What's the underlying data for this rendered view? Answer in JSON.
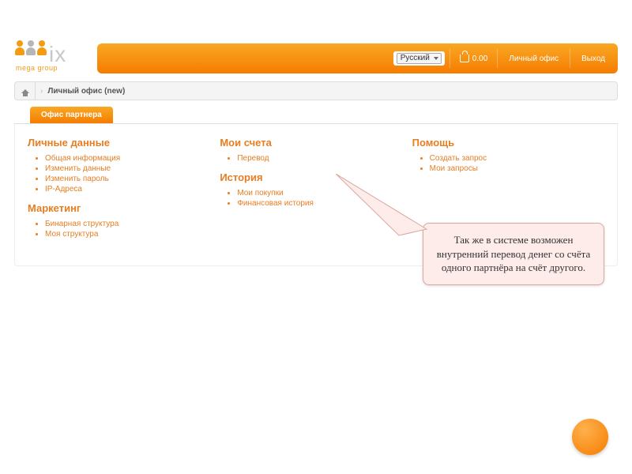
{
  "logo": {
    "text": "ix",
    "prefix_hint": "m",
    "sub": "mega group"
  },
  "topbar": {
    "language": "Русский",
    "balance": "0.00",
    "links": {
      "office": "Личный офис",
      "logout": "Выход"
    }
  },
  "breadcrumb": {
    "current": "Личный офис (new)"
  },
  "tab": {
    "label": "Офис партнера"
  },
  "columns": {
    "personal": {
      "title": "Личные данные",
      "items": [
        "Общая информация",
        "Изменить данные",
        "Изменить пароль",
        "IP-Адреса"
      ]
    },
    "marketing": {
      "title": "Маркетинг",
      "items": [
        "Бинарная структура",
        "Моя структура"
      ]
    },
    "accounts": {
      "title": "Мои счета",
      "items": [
        "Перевод"
      ]
    },
    "history": {
      "title": "История",
      "items": [
        "Мои покупки",
        "Финансовая история"
      ]
    },
    "help": {
      "title": "Помощь",
      "items": [
        "Создать запрос",
        "Мои запросы"
      ]
    }
  },
  "callout": {
    "text": "Так же в системе возможен внутренний перевод денег со счёта одного партнёра на счёт другого."
  }
}
